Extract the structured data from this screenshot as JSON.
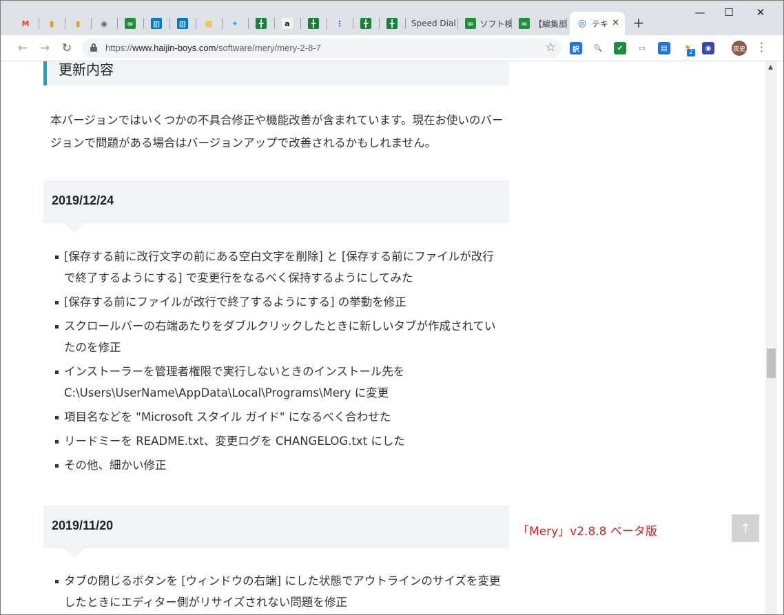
{
  "tabs": [
    {
      "title": "",
      "icon": "gmail-icon",
      "glyph": "M",
      "color": "#ea4335",
      "textcolor": "#ea4335",
      "bg": "transparent"
    },
    {
      "title": "",
      "icon": "analytics-icon",
      "glyph": "▮",
      "color": "#f29900",
      "textcolor": "#f29900",
      "bg": "transparent"
    },
    {
      "title": "",
      "icon": "analytics-icon",
      "glyph": "▮",
      "color": "#f29900",
      "textcolor": "#f29900",
      "bg": "transparent"
    },
    {
      "title": "",
      "icon": "stack-icon",
      "glyph": "◉",
      "color": "#5f6368",
      "textcolor": "#5f6368",
      "bg": "transparent"
    },
    {
      "title": "",
      "icon": "green-app-icon",
      "glyph": "∞",
      "color": "#1e8e3e",
      "textcolor": "#ffffff",
      "bg": "#1e8e3e"
    },
    {
      "title": "",
      "icon": "trello-icon",
      "glyph": "▥",
      "color": "#0079bf",
      "textcolor": "#ffffff",
      "bg": "#0079bf"
    },
    {
      "title": "",
      "icon": "trello-icon",
      "glyph": "▥",
      "color": "#0079bf",
      "textcolor": "#ffffff",
      "bg": "#0079bf"
    },
    {
      "title": "",
      "icon": "calendar-icon",
      "glyph": "▦",
      "color": "#fbbc04",
      "textcolor": "#fbbc04",
      "bg": "transparent"
    },
    {
      "title": "",
      "icon": "twitter-icon",
      "glyph": "✦",
      "color": "#1da1f2",
      "textcolor": "#1da1f2",
      "bg": "transparent"
    },
    {
      "title": "",
      "icon": "sheets-icon",
      "glyph": "╋",
      "color": "#188038",
      "textcolor": "#ffffff",
      "bg": "#188038"
    },
    {
      "title": "",
      "icon": "amazon-icon",
      "glyph": "a",
      "color": "#111111",
      "textcolor": "#111111",
      "bg": "#f3f3f3"
    },
    {
      "title": "",
      "icon": "sheets-icon",
      "glyph": "╋",
      "color": "#188038",
      "textcolor": "#ffffff",
      "bg": "#188038"
    },
    {
      "title": "",
      "icon": "tree-icon",
      "glyph": "⋮",
      "color": "#1a73e8",
      "textcolor": "#1a73e8",
      "bg": "transparent"
    },
    {
      "title": "",
      "icon": "sheets-icon",
      "glyph": "╋",
      "color": "#188038",
      "textcolor": "#ffffff",
      "bg": "#188038"
    },
    {
      "title": "",
      "icon": "sheets-icon",
      "glyph": "╋",
      "color": "#188038",
      "textcolor": "#ffffff",
      "bg": "#188038"
    },
    {
      "title": "Speed Dial",
      "icon": "",
      "glyph": "",
      "color": "",
      "textcolor": "",
      "bg": "transparent"
    },
    {
      "title": "ソフト検",
      "icon": "green-app-icon",
      "glyph": "∞",
      "color": "#1e8e3e",
      "textcolor": "#ffffff",
      "bg": "#1e8e3e"
    },
    {
      "title": "【編集部",
      "icon": "green-app-icon",
      "glyph": "∞",
      "color": "#1e8e3e",
      "textcolor": "#ffffff",
      "bg": "#1e8e3e"
    }
  ],
  "active_tab": {
    "title": "テキ",
    "icon": "spiral-icon",
    "glyph": "◎",
    "color": "#1a73e8"
  },
  "window_controls": {
    "minimize": "—",
    "maximize": "☐",
    "close": "✕"
  },
  "toolbar": {
    "back": "←",
    "forward": "→",
    "reload": "↻",
    "url_scheme": "https://",
    "url_host": "www.haijin-boys.com",
    "url_path": "/software/mery/mery-2-8-7",
    "star": "☆",
    "extensions": [
      {
        "name": "translate-ext-icon",
        "glyph": "訳",
        "bg": "#1a73e8",
        "color": "#ffffff",
        "badge": ""
      },
      {
        "name": "search-ext-icon",
        "glyph": "🔍",
        "bg": "transparent",
        "color": "#5f6368",
        "badge": ""
      },
      {
        "name": "checker-ext-icon",
        "glyph": "✔",
        "bg": "#1e8e3e",
        "color": "#ffffff",
        "badge": ""
      },
      {
        "name": "screen-ext-icon",
        "glyph": "▭",
        "bg": "transparent",
        "color": "#5f6368",
        "badge": ""
      },
      {
        "name": "reader-ext-icon",
        "glyph": "▤",
        "bg": "#1a73e8",
        "color": "#ffffff",
        "badge": ""
      },
      {
        "name": "flag-ext-icon",
        "glyph": "⚑",
        "bg": "transparent",
        "color": "#f29900",
        "badge": "2"
      },
      {
        "name": "circle-ext-icon",
        "glyph": "◉",
        "bg": "#3949ab",
        "color": "#ffffff",
        "badge": ""
      }
    ],
    "avatar_text": "崇史",
    "menu": "⋮"
  },
  "page": {
    "section_heading": "更新内容",
    "intro": "本バージョンではいくつかの不具合修正や機能改善が含まれています。現在お使いのバージョンで問題がある場合はバージョンアップで改善されるかもしれません。",
    "releases": [
      {
        "date": "2019/12/24",
        "items": [
          "[保存する前に改行文字の前にある空白文字を削除] と [保存する前にファイルが改行で終了するようにする] で変更行をなるべく保持するようにしてみた",
          "[保存する前にファイルが改行で終了するようにする] の挙動を修正",
          "スクロールバーの右端あたりをダブルクリックしたときに新しいタブが作成されていたのを修正",
          "インストーラーを管理者権限で実行しないときのインストール先を C:\\Users\\UserName\\AppData\\Local\\Programs\\Mery に変更",
          "項目名などを \"Microsoft スタイル ガイド\" になるべく合わせた",
          "リードミーを README.txt、変更ログを CHANGELOG.txt にした",
          "その他、細かい修正"
        ]
      },
      {
        "date": "2019/11/20",
        "items": [
          "タブの閉じるボタンを [ウィンドウの右端] にした状態でアウトラインのサイズを変更したときにエディター側がリサイズされない問題を修正"
        ]
      }
    ],
    "side_link": "「Mery」v2.8.8 ベータ版",
    "back_to_top": "↑"
  },
  "colors": {
    "accent": "#1aa6c2",
    "heading_bg": "#f1f4f7",
    "link_red": "#d61e1e"
  }
}
